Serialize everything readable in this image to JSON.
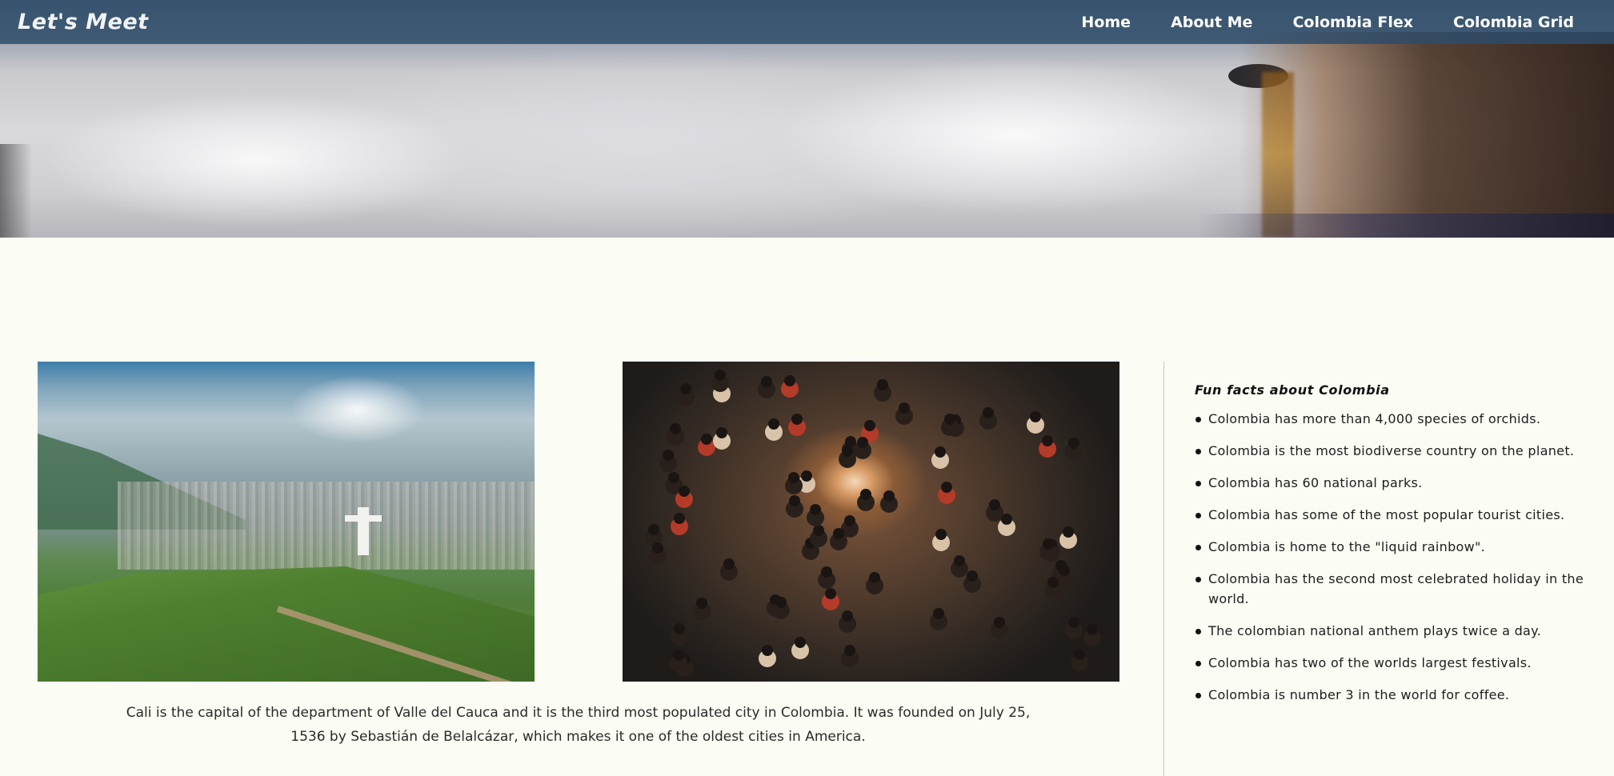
{
  "header": {
    "brand": "Let's Meet",
    "nav": [
      "Home",
      "About Me",
      "Colombia Flex",
      "Colombia Grid"
    ]
  },
  "main": {
    "caption": "Cali is the capital of the department of Valle del Cauca and it is the third most populated city in Colombia. It was founded on July 25, 1536 by Sebastián de Belalcázar, which makes it one of the oldest cities in America."
  },
  "facts": {
    "title": "Fun facts about Colombia",
    "items": [
      "Colombia has more than 4,000 species of orchids.",
      "Colombia is the most biodiverse country on the planet.",
      "Colombia has 60 national parks.",
      "Colombia has some of the most popular tourist cities.",
      "Colombia is home to the \"liquid rainbow\".",
      "Colombia has the second most celebrated holiday in the world.",
      "The colombian national anthem plays twice a day.",
      "Colombia has two of the worlds largest festivals.",
      "Colombia is number 3 in the world for coffee."
    ]
  },
  "colors": {
    "navbar": "#2e4c6a",
    "page_background": "#fbfcf4"
  }
}
